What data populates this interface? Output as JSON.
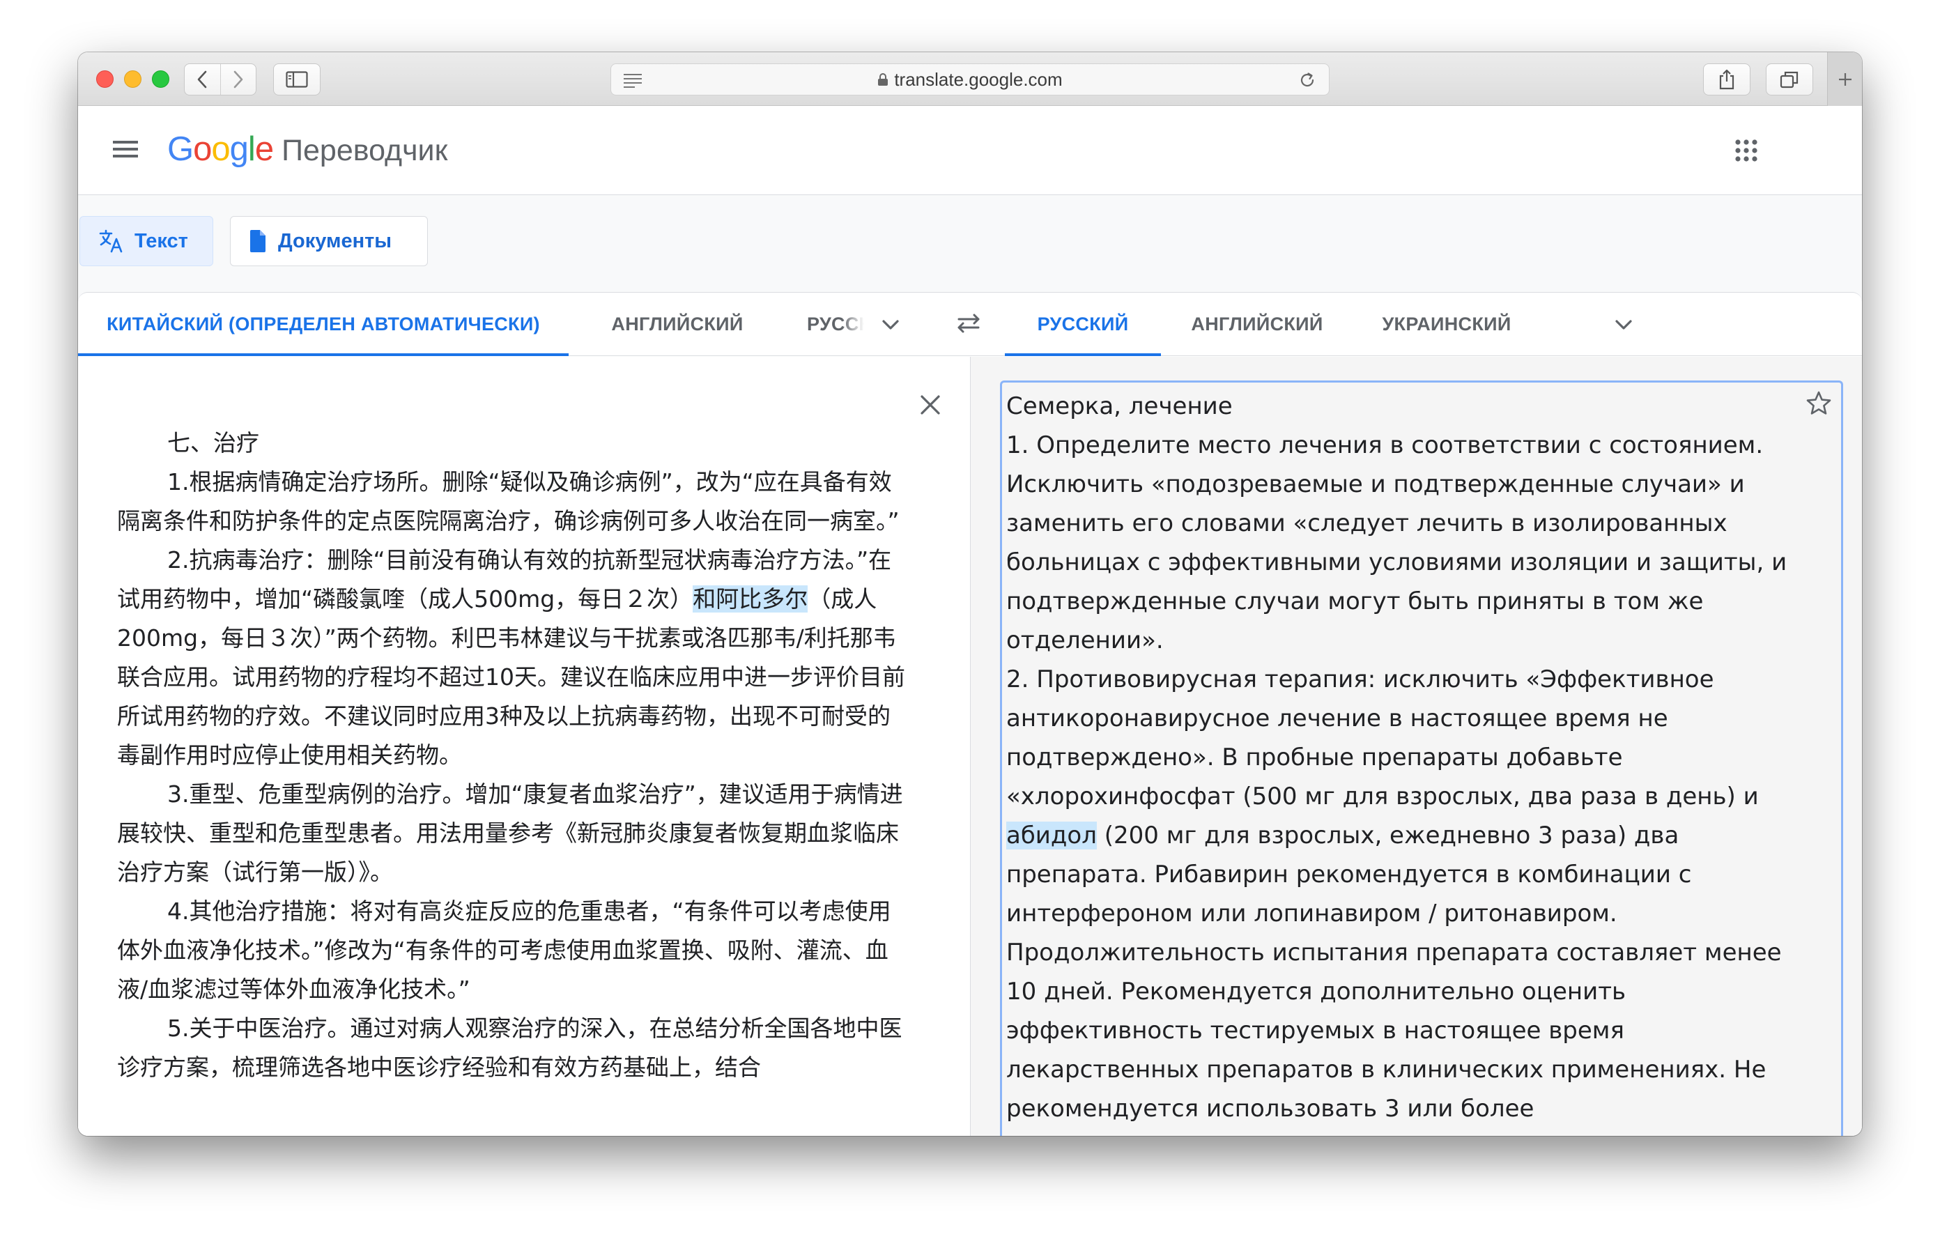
{
  "browser": {
    "url": "translate.google.com"
  },
  "header": {
    "logo_letters": [
      "G",
      "o",
      "o",
      "g",
      "l",
      "e"
    ],
    "product_name": "Переводчик"
  },
  "modes": {
    "text_label": "Текст",
    "documents_label": "Документы"
  },
  "source_languages": {
    "auto": "КИТАЙСКИЙ (ОПРЕДЕЛЕН АВТОМАТИЧЕСКИ)",
    "english": "АНГЛИЙСКИЙ",
    "russian": "РУССКИЙ"
  },
  "target_languages": {
    "russian": "РУССКИЙ",
    "english": "АНГЛИЙСКИЙ",
    "ukrainian": "УКРАИНСКИЙ"
  },
  "source": {
    "heading": "七、治疗",
    "p1": "1.根据病情确定治疗场所。删除“疑似及确诊病例”，改为“应在具备有效隔离条件和防护条件的定点医院隔离治疗，确诊病例可多人收治在同一病室。”",
    "p2_before": "2.抗病毒治疗：删除“目前没有确认有效的抗新型冠状病毒治疗方法。”在试用药物中，增加“磷酸氯喹（成人500mg，每日２次）",
    "p2_highlight": "和阿比多尔",
    "p2_after": "（成人200mg，每日３次）”两个药物。利巴韦林建议与干扰素或洛匹那韦/利托那韦联合应用。试用药物的疗程均不超过10天。建议在临床应用中进一步评价目前所试用药物的疗效。不建议同时应用3种及以上抗病毒药物，出现不可耐受的毒副作用时应停止使用相关药物。",
    "p3": "3.重型、危重型病例的治疗。增加“康复者血浆治疗”，建议适用于病情进展较快、重型和危重型患者。用法用量参考《新冠肺炎康复者恢复期血浆临床治疗方案（试行第一版）》。",
    "p4": "4.其他治疗措施：将对有高炎症反应的危重患者，“有条件可以考虑使用体外血液净化技术。”修改为“有条件的可考虑使用血浆置换、吸附、灌流、血液/血浆滤过等体外血液净化技术。”",
    "p5": "5.关于中医治疗。通过对病人观察治疗的深入，在总结分析全国各地中医诊疗方案，梳理筛选各地中医诊疗经验和有效方药基础上，结合"
  },
  "target": {
    "heading": "Семерка, лечение",
    "p1": "1. Определите место лечения в соответствии с состоянием. Исключить «подозреваемые и подтвержденные случаи» и заменить его словами «следует лечить в изолированных больницах с эффективными условиями изоляции и защиты, и подтвержденные случаи могут быть приняты в том же отделении».",
    "p2_before": "2. Противовирусная терапия: исключить «Эффективное антикоронавирусное лечение в настоящее время не подтверждено». В пробные препараты добавьте «хлорохинфосфат (500 мг для взрослых, два раза в день) и ",
    "p2_highlight": "абидол",
    "p2_after": " (200 мг для взрослых, ежедневно 3 раза) два препарата. Рибавирин рекомендуется в комбинации с интерфероном или лопинавиром / ритонавиром. Продолжительность испытания препарата составляет менее 10 дней. Рекомендуется дополнительно оценить эффективность тестируемых в настоящее время лекарственных препаратов в клинических применениях. Не рекомендуется использовать 3 или более"
  },
  "colors": {
    "accent": "#1a73e8",
    "highlight": "#c9e6fc"
  }
}
